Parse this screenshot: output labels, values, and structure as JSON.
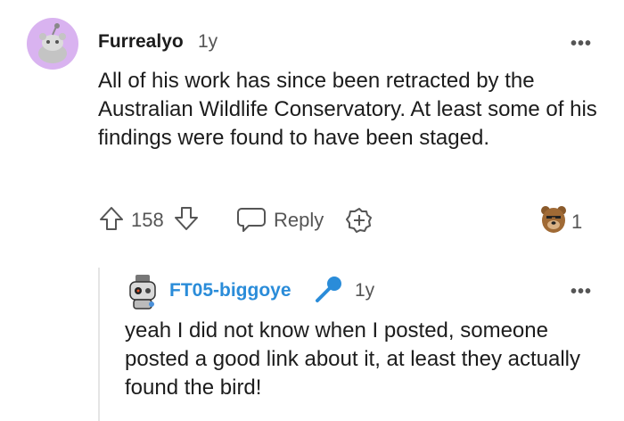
{
  "comment": {
    "author": "Furrealyo",
    "age": "1y",
    "body": "All of his work has since been retracted by the Australian Wildlife Conservatory. At least some of his findings were found to have been staged.",
    "votes": "158",
    "reply_label": "Reply",
    "award_count": "1",
    "avatar_icon": "reddit-snoo-avatar",
    "avatar_color": "#d9b3f0"
  },
  "reply": {
    "author": "FT05-biggoye",
    "age": "1y",
    "body": "yeah I did not know when I posted, someone posted a good link about it, at least they actually found the bird!",
    "flair_icon": "microphone-icon",
    "author_color": "#2a8cd9"
  }
}
